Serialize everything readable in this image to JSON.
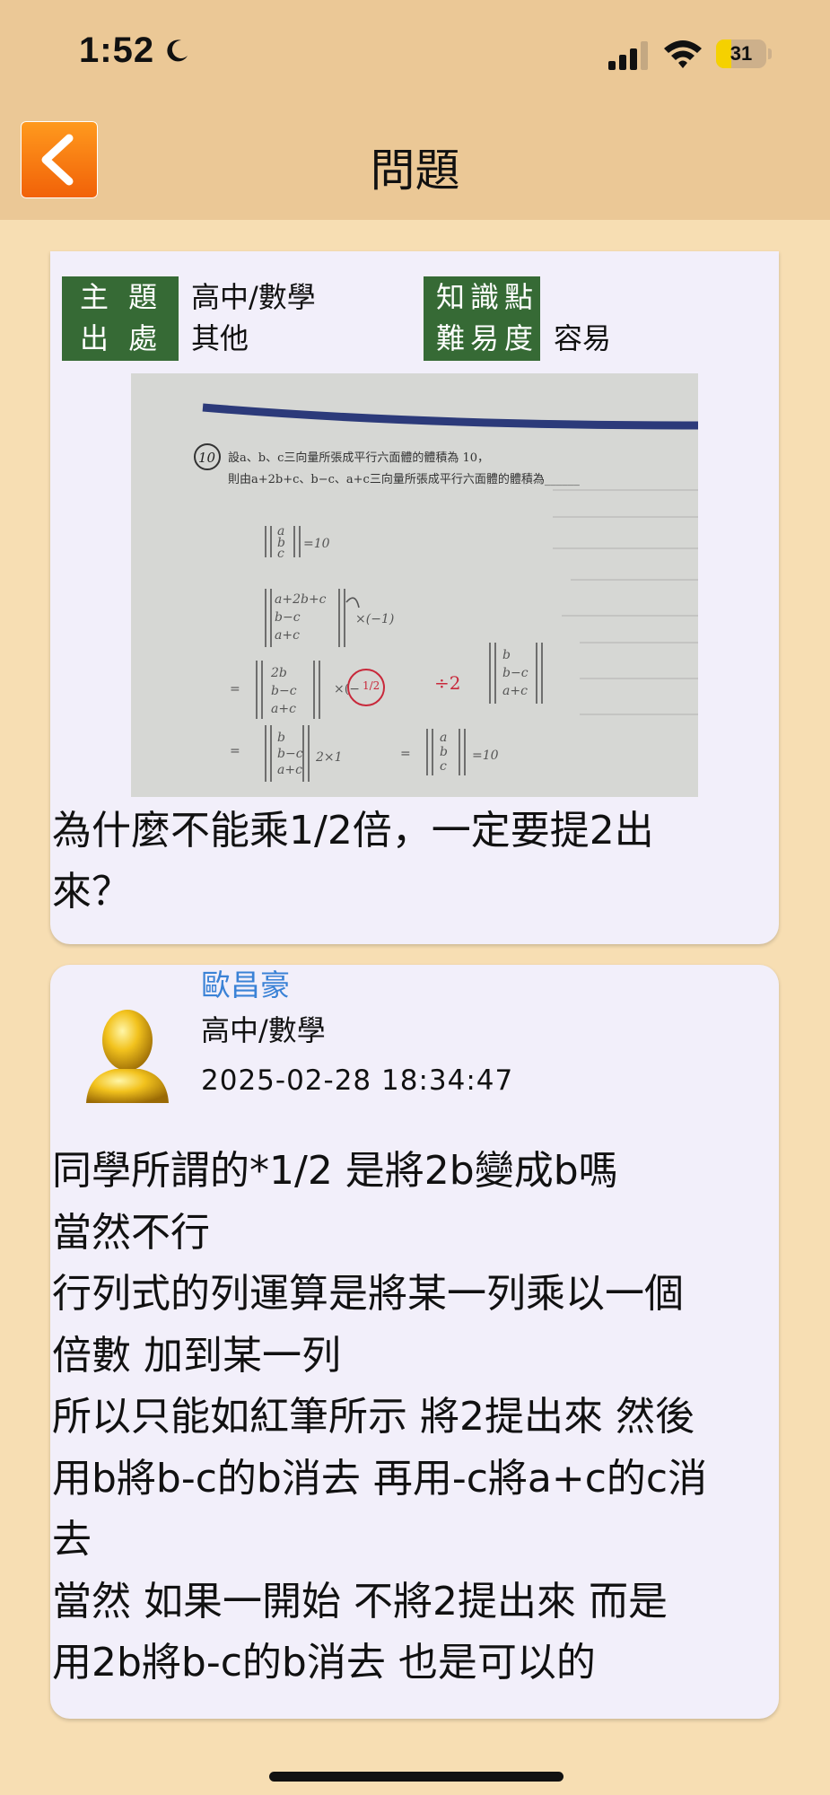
{
  "status_bar": {
    "time": "1:52",
    "battery_level": "31",
    "battery_fraction": 0.31,
    "icons": [
      "moon-icon",
      "signal-icon",
      "wifi-icon",
      "battery-icon"
    ]
  },
  "nav": {
    "title": "問題",
    "back_icon": "chevron-left-icon",
    "back_color": "#f47a12"
  },
  "question": {
    "meta": {
      "topic_label": "主 題",
      "source_label": "出 處",
      "topic_value": "高中/數學",
      "source_value": "其他",
      "knowledge_label": "知識點",
      "difficulty_label": "難易度",
      "knowledge_value": "",
      "difficulty_value": "容易"
    },
    "image": {
      "problem_number": "10",
      "line1": "設a、b、c三向量所張成平行六面體的體積為 10，",
      "line2": "則由a+2b+c、b−c、a+c三向量所張成平行六面體的體積為______"
    },
    "text": "為什麼不能乘1/2倍，一定要提2出\n來？"
  },
  "answer": {
    "author": "歐昌豪",
    "subject": "高中/數學",
    "timestamp": "2025-02-28 18:34:47",
    "text": "同學所謂的*1/2  是將2b變成b嗎\n當然不行\n行列式的列運算是將某一列乘以一個\n倍數  加到某一列\n所以只能如紅筆所示  將2提出來  然後\n用b將b-c的b消去 再用-c將a+c的c消\n去\n當然 如果一開始  不將2提出來  而是\n用2b將b-c的b消去 也是可以的"
  },
  "colors": {
    "page_bg": "#f7deb3",
    "bar_bg": "#ebc896",
    "tag_bg": "#366a35",
    "author_link": "#3a82d6",
    "card_bg": "#f2effa"
  }
}
